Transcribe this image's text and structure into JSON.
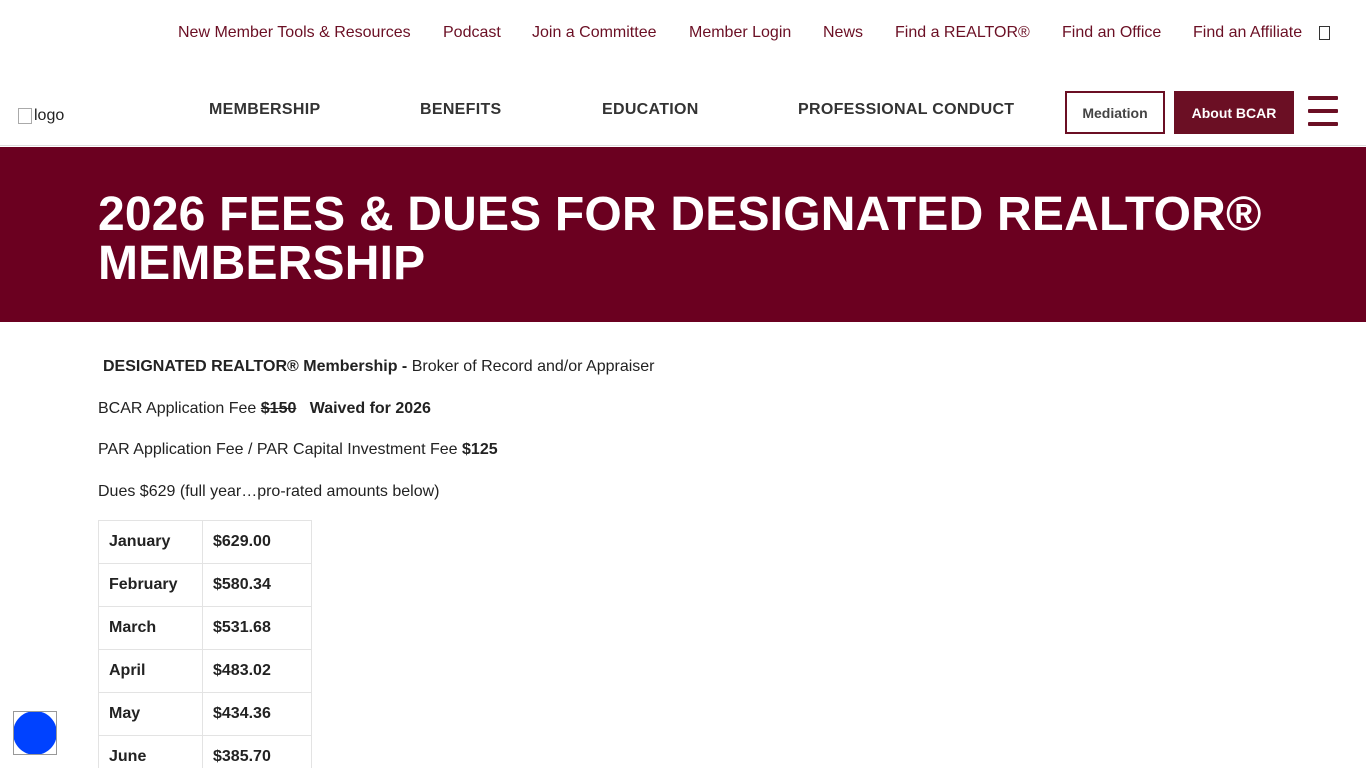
{
  "topbar": {
    "links": [
      "New Member Tools & Resources",
      "Podcast",
      "Join a Committee",
      "Member Login",
      "News",
      "Find a REALTOR®",
      "Find an Office",
      "Find an Affiliate"
    ]
  },
  "logo": {
    "alt": "logo"
  },
  "nav": {
    "items": [
      "MEMBERSHIP",
      "BENEFITS",
      "EDUCATION",
      "PROFESSIONAL CONDUCT"
    ],
    "mediation": "Mediation",
    "about": "About BCAR"
  },
  "banner": {
    "title": "2026 FEES & DUES FOR DESIGNATED REALTOR® MEMBERSHIP"
  },
  "content": {
    "line1_bold": "DESIGNATED REALTOR® Membership -",
    "line1_rest": "Broker of Record and/or Appraiser",
    "line2_text": "BCAR Application Fee",
    "line2_strike": "$150",
    "line2_bold": "Waived for 2026",
    "line3_text": "PAR Application Fee / PAR Capital Investment Fee",
    "line3_bold": "$125",
    "line4_text": "Dues $629 (full year…pro-rated amounts below)",
    "table": [
      {
        "month": "January",
        "amount": "$629.00"
      },
      {
        "month": "February",
        "amount": "$580.34"
      },
      {
        "month": "March",
        "amount": "$531.68"
      },
      {
        "month": "April",
        "amount": "$483.02"
      },
      {
        "month": "May",
        "amount": "$434.36"
      },
      {
        "month": "June",
        "amount": "$385.70"
      }
    ]
  },
  "colors": {
    "brand": "#6b0020",
    "accessibility": "#0042ff"
  }
}
